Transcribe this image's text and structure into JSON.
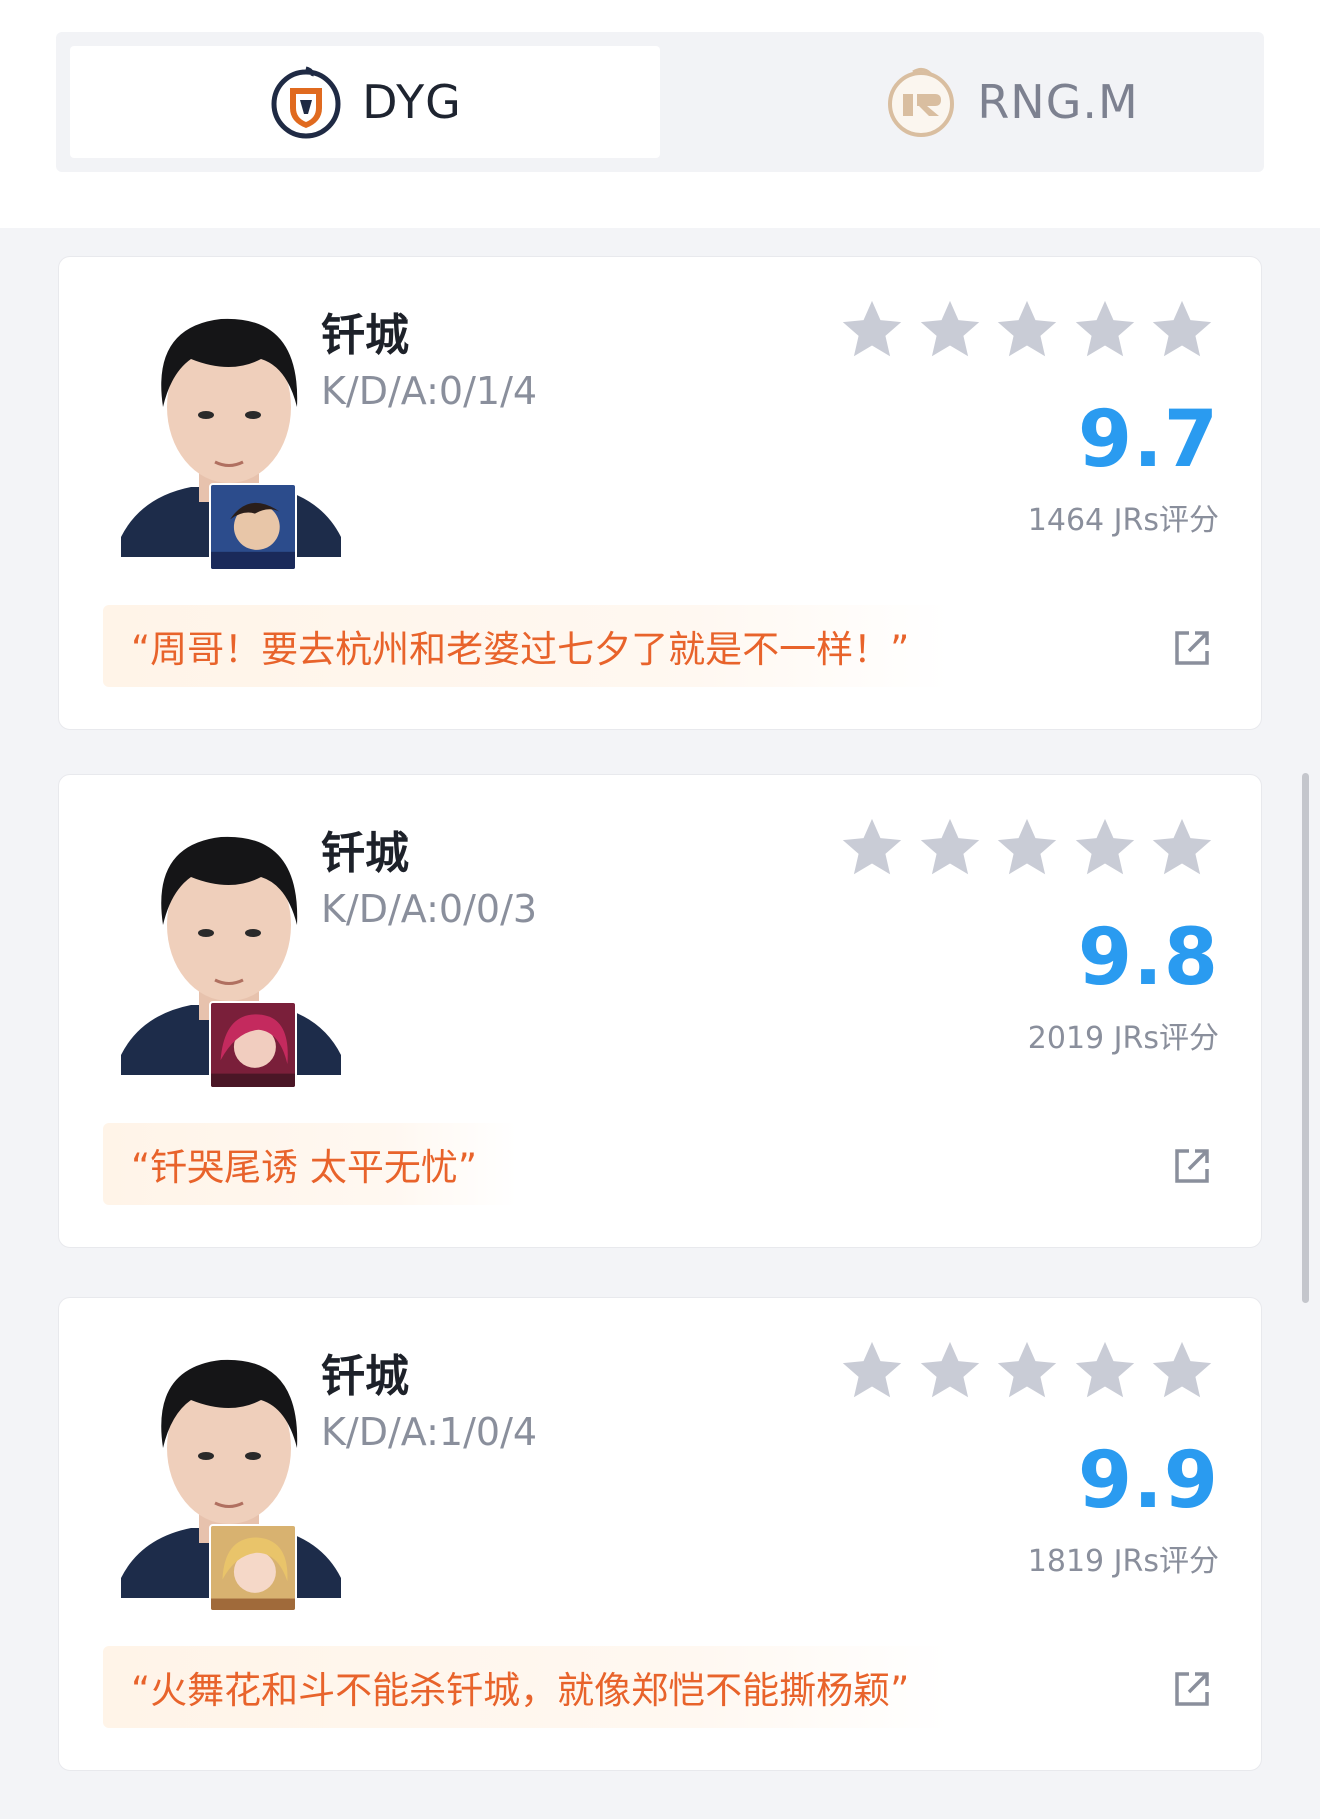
{
  "tabs": [
    {
      "label": "DYG",
      "active": true,
      "logo": "dyg-logo"
    },
    {
      "label": "RNG.M",
      "active": false,
      "logo": "rngm-logo"
    }
  ],
  "colors": {
    "score": "#2a9bf0",
    "quote_text": "#e8632b",
    "star_inactive": "#c9ccd6"
  },
  "cards": [
    {
      "player_name": "钎城",
      "kda": "K/D/A:0/1/4",
      "stars": 5,
      "score": "9.7",
      "rating_count": "1464 JRs评分",
      "quote": "“周哥！要去杭州和老婆过七夕了就是不一样！”",
      "hero_icon": "hero-portrait-icon"
    },
    {
      "player_name": "钎城",
      "kda": "K/D/A:0/0/3",
      "stars": 5,
      "score": "9.8",
      "rating_count": "2019 JRs评分",
      "quote": "“钎哭尾诱 太平无忧”",
      "hero_icon": "hero-portrait-icon"
    },
    {
      "player_name": "钎城",
      "kda": "K/D/A:1/0/4",
      "stars": 5,
      "score": "9.9",
      "rating_count": "1819 JRs评分",
      "quote": "“火舞花和斗不能杀钎城，就像郑恺不能撕杨颖”",
      "hero_icon": "hero-portrait-icon"
    }
  ]
}
